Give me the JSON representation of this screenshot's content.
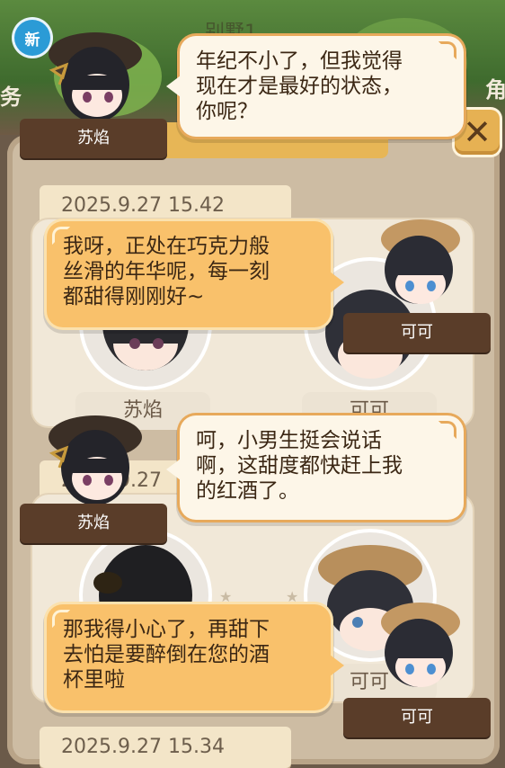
{
  "background": {
    "new_badge": "新",
    "left_edge_text": "务",
    "right_edge_text": "角",
    "top_title": "别墅1",
    "panel_title": "",
    "close_label": "✕",
    "records": [
      {
        "date": "2025.9.27  15.42",
        "left_name": "苏焰",
        "right_name": "可可"
      },
      {
        "date": "2025.9.27",
        "left_name": "",
        "right_name": "可可"
      },
      {
        "date": "2025.9.27  15.34",
        "left_name": "",
        "right_name": ""
      }
    ]
  },
  "dialogue": [
    {
      "speaker": "苏焰",
      "text_lines": [
        "年纪不小了，但我觉得",
        "现在才是最好的状态，",
        "你呢？"
      ],
      "side": "left"
    },
    {
      "speaker": "可可",
      "text_lines": [
        "我呀，正处在巧克力般",
        "丝滑的年华呢，每一刻",
        "都甜得刚刚好~"
      ],
      "side": "right"
    },
    {
      "speaker": "苏焰",
      "text_lines": [
        "呵，小男生挺会说话",
        "啊，这甜度都快赶上我",
        "的红酒了。"
      ],
      "side": "left"
    },
    {
      "speaker": "可可",
      "text_lines": [
        "那我得小心了，再甜下",
        "去怕是要醉倒在您的酒",
        "杯里啦"
      ],
      "side": "right"
    }
  ],
  "colors": {
    "bubble_cream": "#fdf6e8",
    "bubble_orange": "#f9c16b",
    "speaker_tag": "#5a3d29",
    "accent_border": "#e7a95b"
  }
}
